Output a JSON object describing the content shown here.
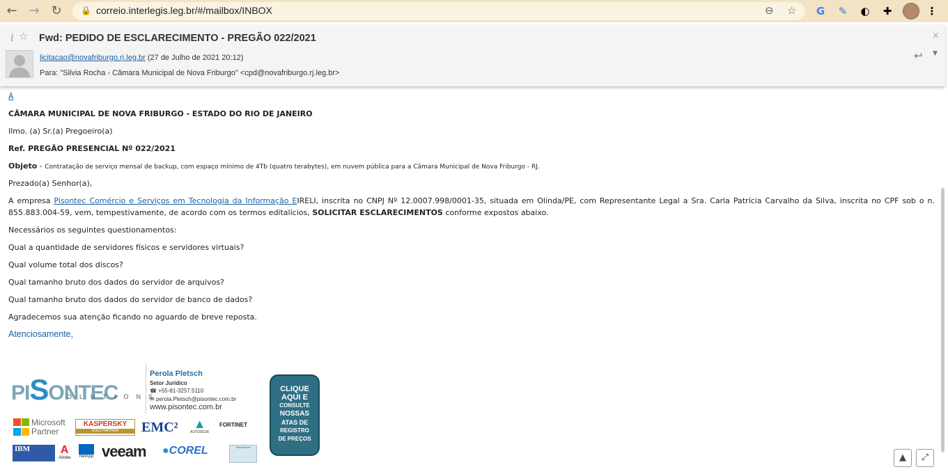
{
  "browser": {
    "url": "correio.interlegis.leg.br/#/mailbox/INBOX",
    "back_icon": "←",
    "forward_icon": "→",
    "reload_icon": "↻",
    "zoom_icon": "⊖",
    "star_icon": "☆",
    "menu_icon": "⋮"
  },
  "email": {
    "subject": "Fwd: PEDIDO DE ESCLARECIMENTO - PREGÃO 022/2021",
    "from_address": "licitacao@novafriburgo.rj.leg.br",
    "date": "(27 de Julho de 2021 20:12)",
    "to_line": "Para: \"Silvia Rocha - Câmara Municipal de Nova Friburgo\" <cpd@novafriburgo.rj.leg.br>"
  },
  "body": {
    "link_a": "À",
    "line1": "CÂMARA MUNICIPAL DE NOVA FRIBURGO - ESTADO DO RIO DE JANEIRO",
    "line2": "Ilmo. (a) Sr.(a) Pregoeiro(a)",
    "line3": "Ref. PREGÃO PRESENCIAL Nº 022/2021",
    "objeto_label": "Objeto",
    "objeto_dash": " - ",
    "objeto_text": "Contratação de serviço mensal de backup, com espaço mínimo de 4Tb (quatro terabytes), em nuvem pública para a Câmara Municipal de Nova Friburgo - RJ.",
    "greeting": "Prezado(a) Senhor(a),",
    "para_pre": "A empresa ",
    "para_link": "Pisontec Comércio e Serviços em Tecnologia da Informação E",
    "para_mid": "IRELI, inscrita no CNPJ Nº 12.0007.998/0001-35, situada em Olinda/PE, com Representante Legal a Sra. Carla Patrícia Carvalho da Silva, inscrita no CPF sob o n. 855.883.004-59, vem, tempestivamente, de acordo com os termos editalícios, ",
    "para_bold": "SOLICITAR ESCLARECIMENTOS",
    "para_end": " conforme expostos abaixo.",
    "q_intro": "Necessários os seguintes questionamentos:",
    "q1": "Qual a quantidade de servidores físicos e servidores virtuais?",
    "q2": "Qual volume total dos discos?",
    "q3": "Qual tamanho bruto dos dados do servidor de arquivos?",
    "q4": "Qual tamanho bruto dos dados do servidor de banco de dados?",
    "thanks": "Agradecemos sua atenção ficando no aguardo de breve reposta.",
    "sign": "Atenciosamente,"
  },
  "signature": {
    "logo_pi": "PI",
    "logo_s": "S",
    "logo_ontec": "ONTEC",
    "logo_solutions": "OLUTIONS",
    "name": "Perola Pletsch",
    "role": "Setor Jurídico",
    "phone": "+55-81-3257.5110",
    "email": "perola.Pletsch@pisontec.com.br",
    "site": "www.pisontec.com.br",
    "badge_lines": [
      "CLIQUE",
      "AQUI E",
      "CONSULTE",
      "NOSSAS",
      "ATAS DE",
      "REGISTRO",
      "DE PREÇOS"
    ],
    "partners": {
      "microsoft": "Microsoft",
      "microsoft_sub": "Partner",
      "kaspersky": "KASPERSKY",
      "kaspersky_sub": "GOLD PARTNER",
      "emc": "EMC²",
      "autodesk": "AUTODESK",
      "fortinet": "FORTINET",
      "ibm": "IBM",
      "adobe": "Adobe",
      "netapp": "NetApp",
      "veeam": "veeam",
      "corel": "COREL",
      "teamviewer": "TeamViewer"
    }
  },
  "colors": {
    "topbar": "#f1e3c4",
    "link": "#1a5fa8",
    "header_bg": "#f4f4f4"
  }
}
